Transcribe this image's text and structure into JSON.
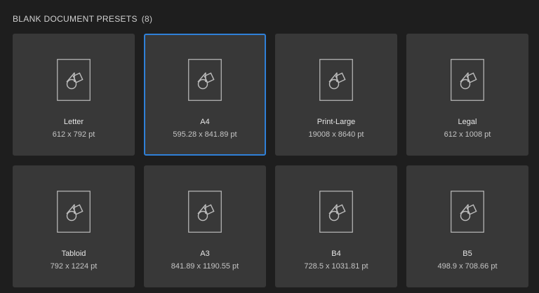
{
  "header": {
    "title": "BLANK DOCUMENT PRESETS",
    "count": "(8)"
  },
  "presets": [
    {
      "name": "Letter",
      "size": "612 x 792 pt",
      "icon": "document-preset-icon",
      "selected": false
    },
    {
      "name": "A4",
      "size": "595.28 x 841.89 pt",
      "icon": "document-preset-icon",
      "selected": true
    },
    {
      "name": "Print-Large",
      "size": "19008 x 8640 pt",
      "icon": "document-preset-icon",
      "selected": false
    },
    {
      "name": "Legal",
      "size": "612 x 1008 pt",
      "icon": "document-preset-icon",
      "selected": false
    },
    {
      "name": "Tabloid",
      "size": "792 x 1224 pt",
      "icon": "document-preset-icon",
      "selected": false
    },
    {
      "name": "A3",
      "size": "841.89 x 1190.55 pt",
      "icon": "document-preset-icon",
      "selected": false
    },
    {
      "name": "B4",
      "size": "728.5 x 1031.81 pt",
      "icon": "document-preset-icon",
      "selected": false
    },
    {
      "name": "B5",
      "size": "498.9 x 708.66 pt",
      "icon": "document-preset-icon",
      "selected": false
    }
  ],
  "colors": {
    "background": "#1e1e1e",
    "card": "#383838",
    "selection": "#2f80d8",
    "icon_stroke": "#bdbdbd"
  }
}
